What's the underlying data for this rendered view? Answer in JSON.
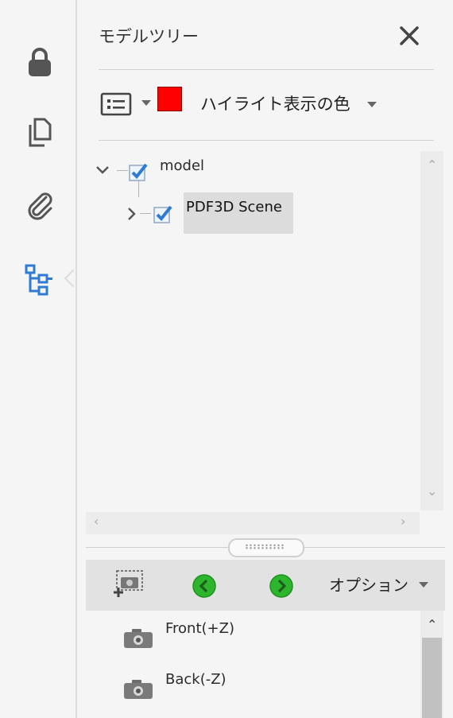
{
  "rail": {
    "items": [
      {
        "name": "lock-icon"
      },
      {
        "name": "pages-icon"
      },
      {
        "name": "attachment-icon"
      },
      {
        "name": "model-tree-icon",
        "active": true
      }
    ]
  },
  "header": {
    "title": "モデルツリー",
    "close_icon": "close-icon"
  },
  "toolbar": {
    "highlight_color_hex": "#ff0000",
    "highlight_label": "ハイライト表示の色"
  },
  "tree": {
    "nodes": [
      {
        "label": "model",
        "checked": true,
        "expanded": true
      },
      {
        "label": "PDF3D Scene",
        "checked": true,
        "expanded": false,
        "selected": true
      }
    ]
  },
  "views_toolbar": {
    "options_label": "オプション"
  },
  "views": [
    {
      "label": "Front(+Z)"
    },
    {
      "label": "Back(-Z)"
    }
  ],
  "colors": {
    "accent_blue": "#2f7bd4",
    "nav_green": "#2db52d"
  }
}
